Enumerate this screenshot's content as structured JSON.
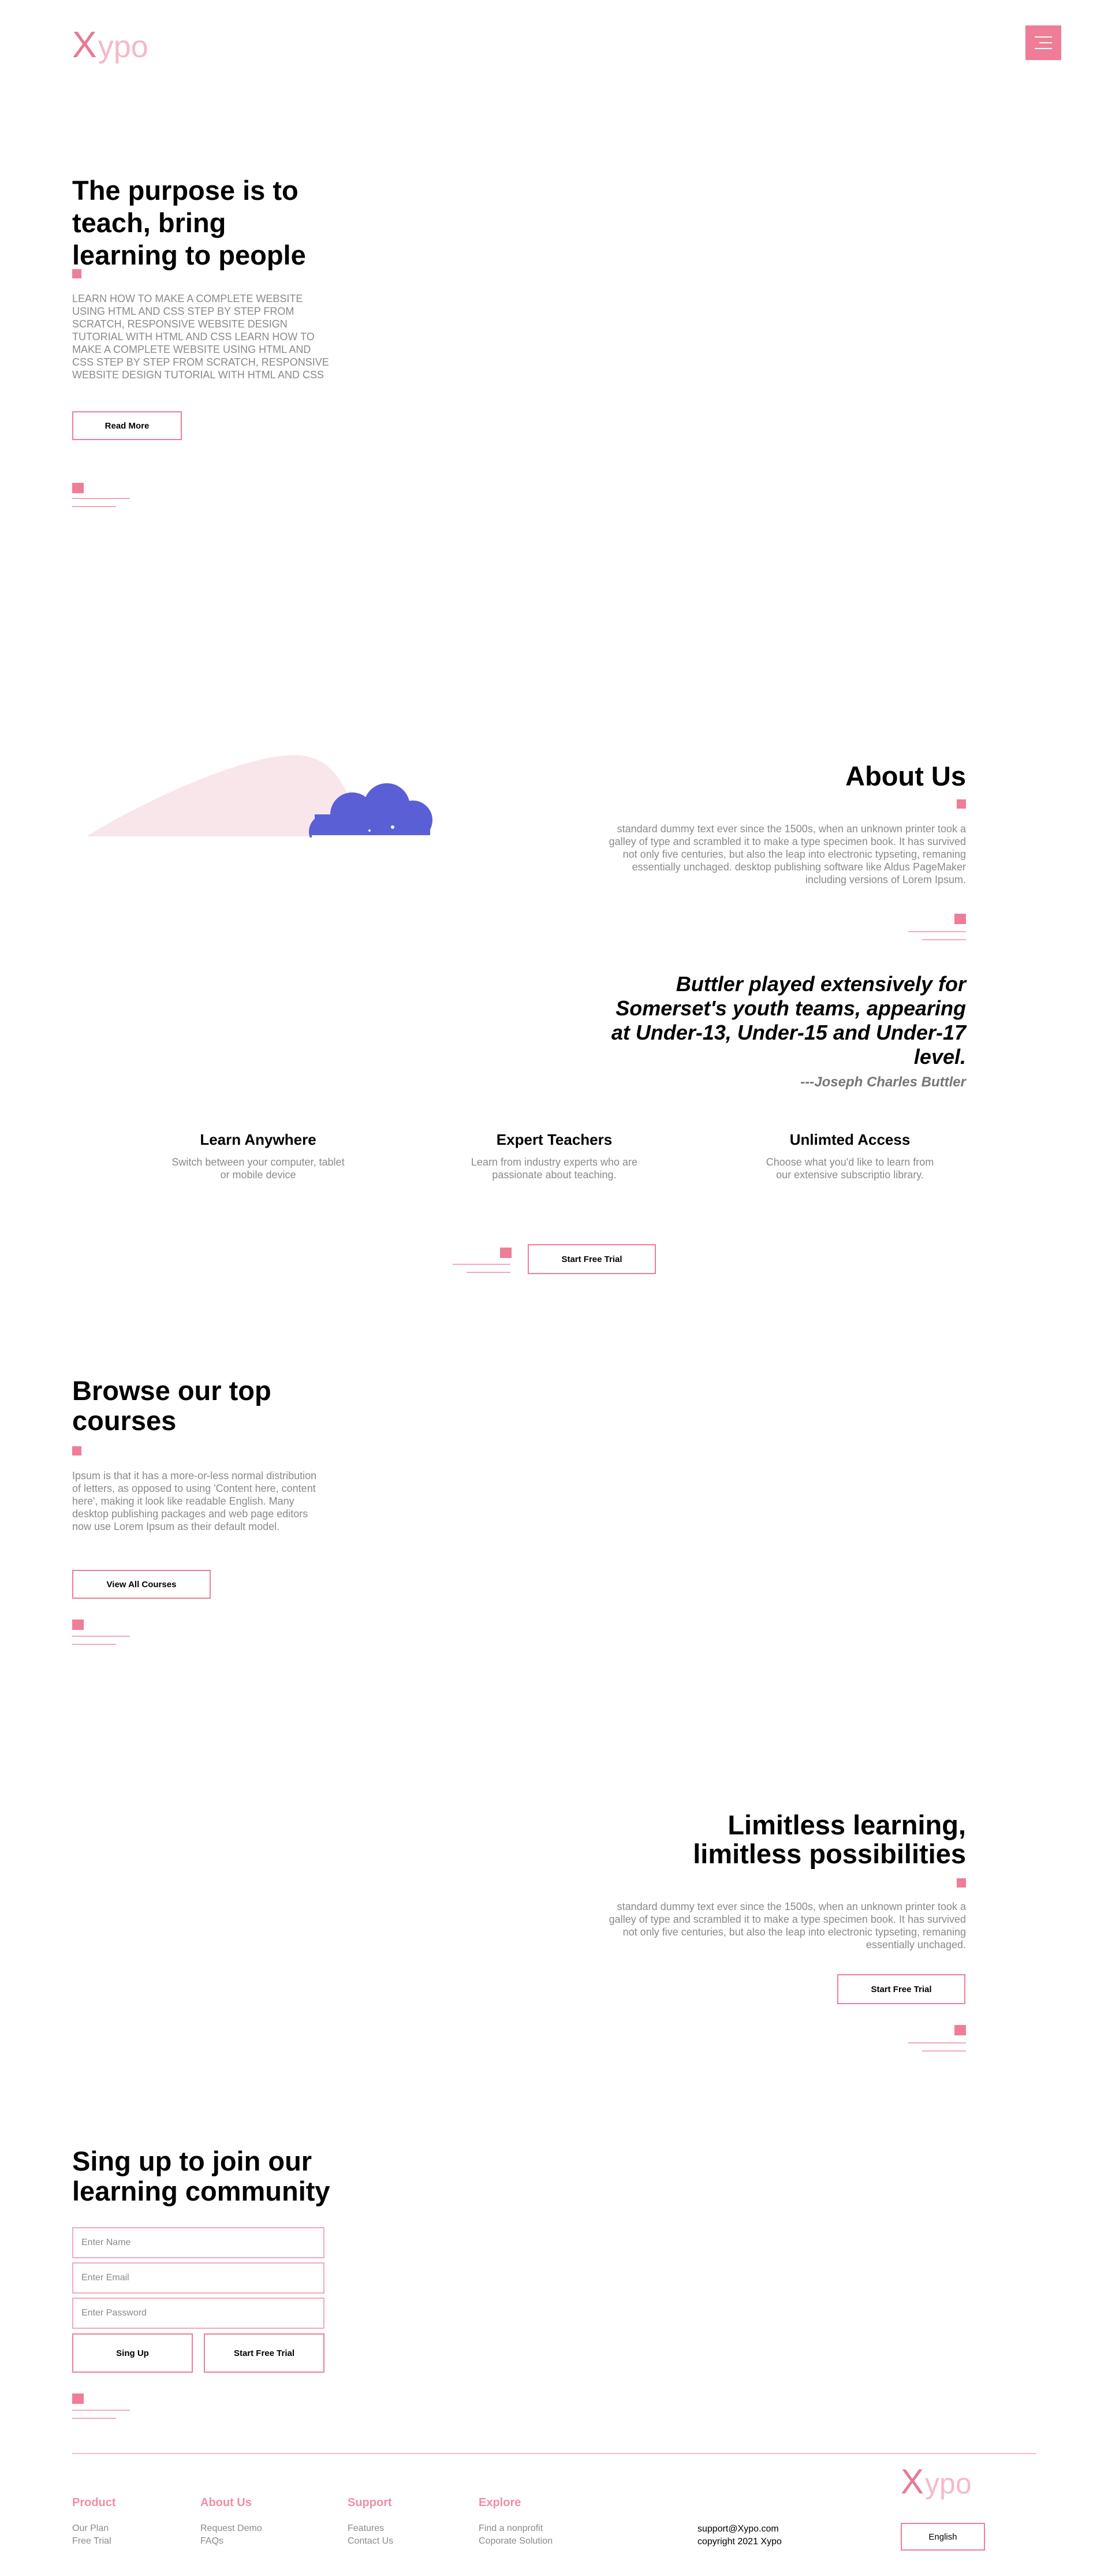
{
  "header": {
    "logo_x": "X",
    "logo_rest": "ypo",
    "colors": {
      "accent": "#ef7d97",
      "accent_light": "#f5b9c7",
      "cloud": "#5b5fd6",
      "blob": "#f8e6ea"
    }
  },
  "hero": {
    "title": "The purpose is to teach, bring learning to people",
    "paragraph": "LEARN HOW TO MAKE A COMPLETE WEBSITE USING HTML AND CSS STEP BY STEP FROM SCRATCH, RESPONSIVE WEBSITE DESIGN TUTORIAL WITH HTML AND CSS LEARN HOW TO MAKE A COMPLETE WEBSITE USING HTML AND CSS STEP BY STEP FROM SCRATCH, RESPONSIVE WEBSITE DESIGN TUTORIAL WITH HTML AND CSS",
    "button": "Read More"
  },
  "about": {
    "title": "About Us",
    "paragraph": "standard dummy text ever since the 1500s, when an unknown printer took a galley of type and scrambled it to make a type specimen book. It has survived not only five centuries, but also the leap into electronic typseting, remaning essentially unchaged. desktop publishing software like Aldus PageMaker including versions of Lorem Ipsum.",
    "quote": "Buttler played extensively for Somerset's youth teams, appearing at Under-13, Under-15 and Under-17 level.",
    "quote_author": "---Joseph Charles Buttler"
  },
  "features": [
    {
      "title": "Learn Anywhere",
      "text": "Switch between your computer, tablet or mobile device"
    },
    {
      "title": "Expert Teachers",
      "text": "Learn from industry experts who are passionate about teaching."
    },
    {
      "title": "Unlimted Access",
      "text": "Choose what you'd like to learn from our extensive subscriptio library."
    }
  ],
  "trial": {
    "button": "Start Free Trial"
  },
  "courses": {
    "title": "Browse our top courses",
    "paragraph": "Ipsum is that it has a more-or-less normal distribution of letters, as opposed to using 'Content here, content here', making it look like readable English. Many desktop publishing packages and web page editors now use Lorem Ipsum as their default model.",
    "button": "View All Courses"
  },
  "limitless": {
    "title": "Limitless learning, limitless possibilities",
    "paragraph": "standard dummy text ever since the 1500s, when an unknown printer took a galley of type and scrambled it to make a type specimen book. It has survived not only five centuries, but also the leap into electronic typseting, remaning essentially unchaged.",
    "button": "Start Free Trial"
  },
  "signup": {
    "title": "Sing up to join our learning community",
    "name_placeholder": "Enter Name",
    "email_placeholder": "Enter Email",
    "password_placeholder": "Enter Password",
    "signup_button": "Sing Up",
    "trial_button": "Start Free Trial"
  },
  "footer": {
    "columns": [
      {
        "heading": "Product",
        "links": [
          "Our Plan",
          "Free Trial"
        ]
      },
      {
        "heading": "About Us",
        "links": [
          "Request Demo",
          "FAQs"
        ]
      },
      {
        "heading": "Support",
        "links": [
          "Features",
          "Contact Us"
        ]
      },
      {
        "heading": "Explore",
        "links": [
          "Find a nonprofit",
          "Coporate Solution"
        ]
      }
    ],
    "email": "support@Xypo.com",
    "copyright": "copyright 2021 Xypo",
    "language": "English"
  }
}
